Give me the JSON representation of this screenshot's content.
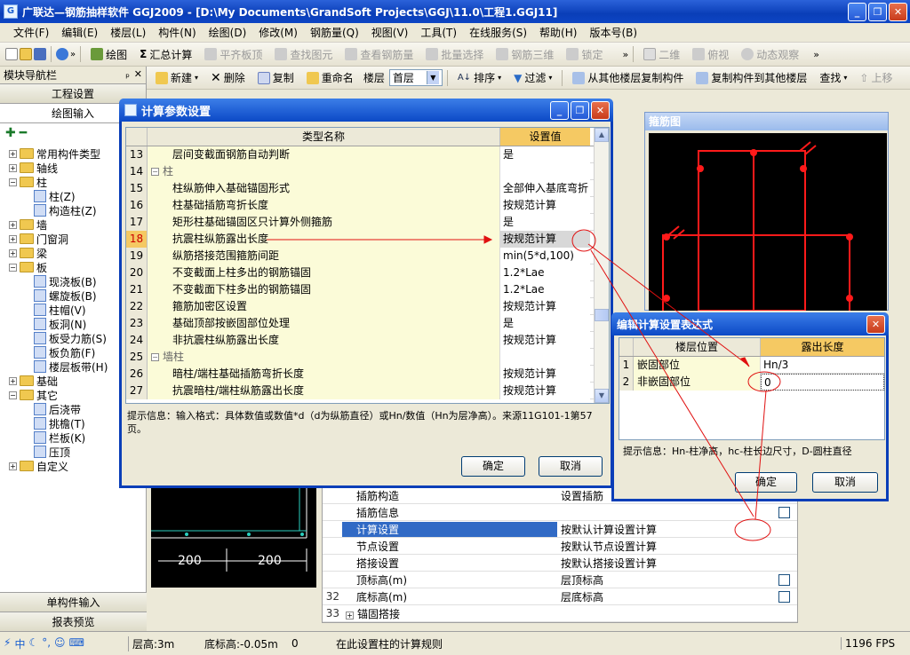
{
  "window": {
    "title": "广联达—钢筋抽样软件 GGJ2009 - [D:\\My Documents\\GrandSoft Projects\\GGJ\\11.0\\工程1.GGJ11]",
    "minimize": "_",
    "restore": "❐",
    "close": "✕"
  },
  "menu": [
    "文件(F)",
    "编辑(E)",
    "楼层(L)",
    "构件(N)",
    "绘图(D)",
    "修改(M)",
    "钢筋量(Q)",
    "视图(V)",
    "工具(T)",
    "在线服务(S)",
    "帮助(H)",
    "版本号(B)"
  ],
  "toolbar1": {
    "draw": "绘图",
    "sum": "汇总计算",
    "flat_top": "平齐板顶",
    "find_element": "查找图元",
    "view_rebar": "查看钢筋量",
    "batch_select": "批量选择",
    "rebar_3d": "钢筋三维",
    "lock": "锁定",
    "view_2d": "二维",
    "top_view": "俯视",
    "dynamic_view": "动态观察",
    "more": "»"
  },
  "toolbar2": {
    "new": "新建",
    "delete": "删除",
    "copy": "复制",
    "rename": "重命名",
    "floor_label": "楼层",
    "floor_value": "首层",
    "sort": "排序",
    "filter": "过滤",
    "copy_from_floor": "从其他楼层复制构件",
    "copy_to_floor": "复制构件到其他楼层",
    "find": "查找",
    "move_up": "上移"
  },
  "nav": {
    "title": "模块导航栏",
    "pin": "ₚ",
    "close": "✕",
    "tab_project": "工程设置",
    "tab_draw": "绘图输入",
    "tree": [
      {
        "level": 0,
        "pm": "+",
        "label": "常用构件类型",
        "type": "folder"
      },
      {
        "level": 0,
        "pm": "+",
        "label": "轴线",
        "type": "folder"
      },
      {
        "level": 0,
        "pm": "−",
        "label": "柱",
        "type": "folder"
      },
      {
        "level": 1,
        "pm": "",
        "label": "柱(Z)",
        "type": "leaf"
      },
      {
        "level": 1,
        "pm": "",
        "label": "构造柱(Z)",
        "type": "leaf"
      },
      {
        "level": 0,
        "pm": "+",
        "label": "墙",
        "type": "folder"
      },
      {
        "level": 0,
        "pm": "+",
        "label": "门窗洞",
        "type": "folder"
      },
      {
        "level": 0,
        "pm": "+",
        "label": "梁",
        "type": "folder"
      },
      {
        "level": 0,
        "pm": "−",
        "label": "板",
        "type": "folder"
      },
      {
        "level": 1,
        "pm": "",
        "label": "现浇板(B)",
        "type": "leaf"
      },
      {
        "level": 1,
        "pm": "",
        "label": "螺旋板(B)",
        "type": "leaf"
      },
      {
        "level": 1,
        "pm": "",
        "label": "柱帽(V)",
        "type": "leaf"
      },
      {
        "level": 1,
        "pm": "",
        "label": "板洞(N)",
        "type": "leaf"
      },
      {
        "level": 1,
        "pm": "",
        "label": "板受力筋(S)",
        "type": "leaf"
      },
      {
        "level": 1,
        "pm": "",
        "label": "板负筋(F)",
        "type": "leaf"
      },
      {
        "level": 1,
        "pm": "",
        "label": "楼层板带(H)",
        "type": "leaf"
      },
      {
        "level": 0,
        "pm": "+",
        "label": "基础",
        "type": "folder"
      },
      {
        "level": 0,
        "pm": "−",
        "label": "其它",
        "type": "folder"
      },
      {
        "level": 1,
        "pm": "",
        "label": "后浇带",
        "type": "leaf"
      },
      {
        "level": 1,
        "pm": "",
        "label": "挑檐(T)",
        "type": "leaf"
      },
      {
        "level": 1,
        "pm": "",
        "label": "栏板(K)",
        "type": "leaf"
      },
      {
        "level": 1,
        "pm": "",
        "label": "压顶",
        "type": "leaf"
      },
      {
        "level": 0,
        "pm": "+",
        "label": "自定义",
        "type": "folder"
      }
    ],
    "btn_single": "单构件输入",
    "btn_report": "报表预览"
  },
  "dialog": {
    "title": "计算参数设置",
    "col_name": "类型名称",
    "col_value": "设置值",
    "rows": [
      {
        "num": "13",
        "name": "层间变截面钢筋自动判断",
        "value": "是",
        "indent": 1
      },
      {
        "num": "14",
        "name": "柱",
        "value": "",
        "indent": 0,
        "group": true
      },
      {
        "num": "15",
        "name": "柱纵筋伸入基础锚固形式",
        "value": "全部伸入基底弯折",
        "indent": 1
      },
      {
        "num": "16",
        "name": "柱基础插筋弯折长度",
        "value": "按规范计算",
        "indent": 1
      },
      {
        "num": "17",
        "name": "矩形柱基础锚固区只计算外侧箍筋",
        "value": "是",
        "indent": 1
      },
      {
        "num": "18",
        "name": "抗震柱纵筋露出长度",
        "value": "按规范计算",
        "indent": 1,
        "current": true
      },
      {
        "num": "19",
        "name": "纵筋搭接范围箍筋间距",
        "value": "min(5*d,100)",
        "indent": 1
      },
      {
        "num": "20",
        "name": "不变截面上柱多出的钢筋锚固",
        "value": "1.2*Lae",
        "indent": 1
      },
      {
        "num": "21",
        "name": "不变截面下柱多出的钢筋锚固",
        "value": "1.2*Lae",
        "indent": 1
      },
      {
        "num": "22",
        "name": "箍筋加密区设置",
        "value": "按规范计算",
        "indent": 1
      },
      {
        "num": "23",
        "name": "基础顶部按嵌固部位处理",
        "value": "是",
        "indent": 1
      },
      {
        "num": "24",
        "name": "非抗震柱纵筋露出长度",
        "value": "按规范计算",
        "indent": 1
      },
      {
        "num": "25",
        "name": "墙柱",
        "value": "",
        "indent": 0,
        "group": true
      },
      {
        "num": "26",
        "name": "暗柱/端柱基础插筋弯折长度",
        "value": "按规范计算",
        "indent": 1
      },
      {
        "num": "27",
        "name": "抗震暗柱/端柱纵筋露出长度",
        "value": "按规范计算",
        "indent": 1
      }
    ],
    "hint": "提示信息：输入格式：具体数值或数值*d（d为纵筋直径）或Hn/数值（Hn为层净高）。来源11G101-1第57页。",
    "ok": "确定",
    "cancel": "取消"
  },
  "dialog2": {
    "title": "编辑计算设置表达式",
    "col_pos": "楼层位置",
    "col_len": "露出长度",
    "rows": [
      {
        "num": "1",
        "pos": "嵌固部位",
        "len": "Hn/3"
      },
      {
        "num": "2",
        "pos": "非嵌固部位",
        "len": "0"
      }
    ],
    "hint": "提示信息：Hn-柱净高，hc-柱长边尺寸，D-圆柱直径",
    "ok": "确定",
    "cancel": "取消"
  },
  "rebar_panel": {
    "title": "箍筋图"
  },
  "cad": {
    "dim1": "200",
    "dim2": "200",
    "dim3": "200"
  },
  "props": {
    "rows": [
      {
        "num": "",
        "name": "插筋构造",
        "value": "设置插筋",
        "check": false,
        "sel": false
      },
      {
        "num": "",
        "name": "插筋信息",
        "value": "",
        "check": true,
        "sel": false
      },
      {
        "num": "",
        "name": "计算设置",
        "value": "按默认计算设置计算",
        "check": false,
        "sel": true
      },
      {
        "num": "",
        "name": "节点设置",
        "value": "按默认节点设置计算",
        "check": false,
        "sel": false
      },
      {
        "num": "",
        "name": "搭接设置",
        "value": "按默认搭接设置计算",
        "check": false,
        "sel": false
      },
      {
        "num": "",
        "name": "顶标高(m)",
        "value": "层顶标高",
        "check": true,
        "sel": false
      },
      {
        "num": "32",
        "name": "底标高(m)",
        "value": "层底标高",
        "check": true,
        "sel": false
      },
      {
        "num": "33",
        "name": "锚固搭接",
        "value": "",
        "check": false,
        "sel": false,
        "group": true
      }
    ]
  },
  "status": {
    "floor_height": "层高:3m",
    "base_height": "底标高:-0.05m",
    "zero": "0",
    "message": "在此设置柱的计算规则",
    "fps": "1196 FPS"
  }
}
